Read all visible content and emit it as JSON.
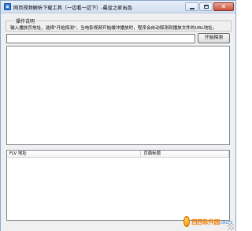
{
  "window": {
    "title": "网页视频解析下载工具（一边看一边下）-最盆之家出品"
  },
  "instructions": {
    "group_title": "操作说明",
    "text": "输入播放页地址，选择\"开始探测\"，当电影视频开始缓冲播放时，程序会自动探测到播放文件的URL地址。"
  },
  "url_bar": {
    "value": "",
    "placeholder": "",
    "probe_button_label": "开始探测"
  },
  "log_area": {
    "content": ""
  },
  "results_table": {
    "columns": [
      "FLV 地址",
      "页面标题"
    ],
    "rows": []
  },
  "watermark": {
    "text": "西西软件园",
    "subtext": "CR173"
  }
}
